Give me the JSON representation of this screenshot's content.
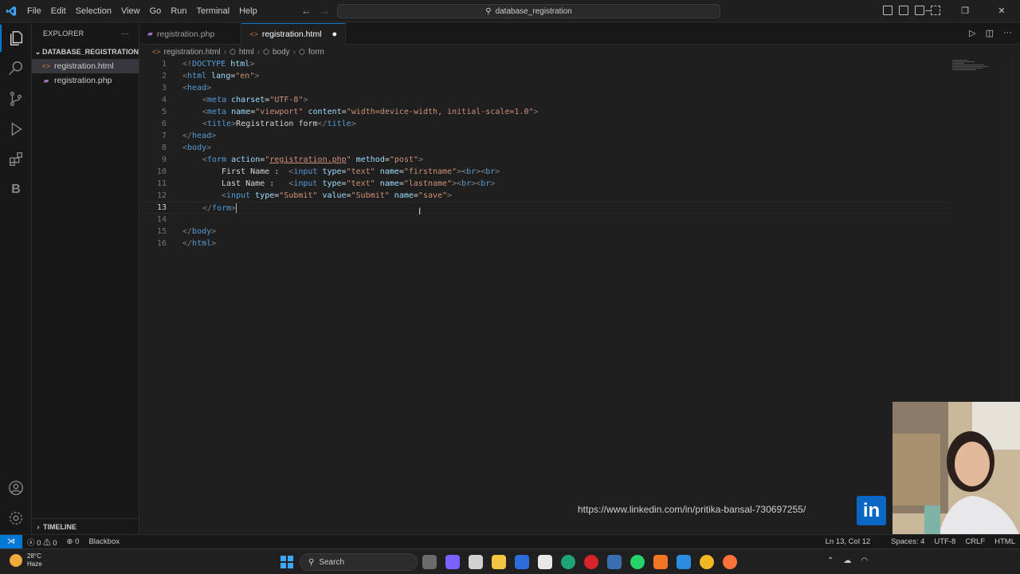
{
  "titlebar": {
    "menu": [
      "File",
      "Edit",
      "Selection",
      "View",
      "Go",
      "Run",
      "Terminal",
      "Help"
    ],
    "search": "database_registration"
  },
  "sidebar": {
    "header": "EXPLORER",
    "section": "DATABASE_REGISTRATION",
    "files": [
      {
        "name": "registration.html",
        "icon": "html-file-icon"
      },
      {
        "name": "registration.php",
        "icon": "php-file-icon"
      }
    ],
    "timeline": "TIMELINE"
  },
  "tabs": [
    {
      "label": "registration.php",
      "active": false
    },
    {
      "label": "registration.html",
      "active": true
    }
  ],
  "breadcrumb": [
    "registration.html",
    "html",
    "body",
    "form"
  ],
  "editor": {
    "current_line": 13,
    "lines": [
      {
        "n": "1"
      },
      {
        "n": "2"
      },
      {
        "n": "3"
      },
      {
        "n": "4"
      },
      {
        "n": "5"
      },
      {
        "n": "6"
      },
      {
        "n": "7"
      },
      {
        "n": "8"
      },
      {
        "n": "9"
      },
      {
        "n": "10"
      },
      {
        "n": "11"
      },
      {
        "n": "12"
      },
      {
        "n": "13"
      },
      {
        "n": "14"
      },
      {
        "n": "15"
      },
      {
        "n": "16"
      }
    ],
    "code": {
      "l1": [
        "<!",
        "DOCTYPE",
        " html",
        ">"
      ],
      "l2": [
        "<",
        "html",
        " lang",
        "=",
        "\"en\"",
        ">"
      ],
      "l3": [
        "<",
        "head",
        ">"
      ],
      "l4": [
        "<",
        "meta",
        " charset",
        "=",
        "\"UTF-8\"",
        ">"
      ],
      "l5": [
        "<",
        "meta",
        " name",
        "=",
        "\"viewport\"",
        " content",
        "=",
        "\"width=device-width, initial-scale=1.0\"",
        ">"
      ],
      "l6": [
        "<",
        "title",
        ">",
        "Registration form",
        "</",
        "title",
        ">"
      ],
      "l7": [
        "</",
        "head",
        ">"
      ],
      "l8": [
        "<",
        "body",
        ">"
      ],
      "l9": [
        "<",
        "form",
        " action",
        "=",
        "\"",
        "registration.php",
        "\"",
        " method",
        "=",
        "\"post\"",
        ">"
      ],
      "l10": [
        "First Name :  ",
        "<",
        "input",
        " type",
        "=",
        "\"text\"",
        " name",
        "=",
        "\"firstname\"",
        "><",
        "br",
        "><",
        "br",
        ">"
      ],
      "l11": [
        "Last Name :   ",
        "<",
        "input",
        " type",
        "=",
        "\"text\"",
        " name",
        "=",
        "\"lastname\"",
        "><",
        "br",
        "><",
        "br",
        ">"
      ],
      "l12": [
        "<",
        "input",
        " type",
        "=",
        "\"Submit\"",
        " value",
        "=",
        "\"Submit\"",
        " name",
        "=",
        "\"save\"",
        ">"
      ],
      "l13": [
        "</",
        "form",
        ">"
      ],
      "l15": [
        "</",
        "body",
        ">"
      ],
      "l16": [
        "</",
        "html",
        ">"
      ]
    }
  },
  "statusbar": {
    "errors": "0",
    "warnings": "0",
    "ports": "0",
    "blackbox": "Blackbox",
    "position": "Ln 13, Col 12",
    "spaces": "Spaces: 4",
    "encoding": "UTF-8",
    "eol": "CRLF",
    "language": "HTML"
  },
  "overlay": {
    "linkedin_url": "https://www.linkedin.com/in/pritika-bansal-730697255/",
    "linkedin_logo": "in"
  },
  "taskbar": {
    "temp": "28°C",
    "weather": "Haze",
    "search": "Search"
  },
  "colors": {
    "accent": "#0078d4",
    "tag": "#569cd6",
    "attr": "#9cdcfe",
    "string": "#ce9178",
    "linkedin": "#0a66c2"
  }
}
